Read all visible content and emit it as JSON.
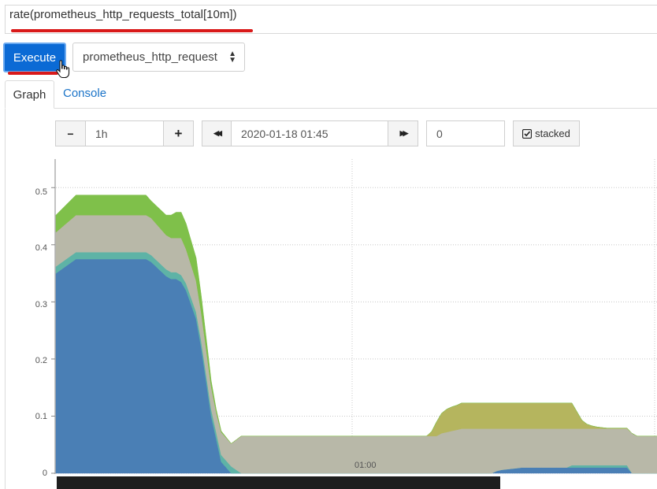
{
  "query": {
    "expression": "rate(prometheus_http_requests_total[10m])"
  },
  "toolbar": {
    "execute_label": "Execute",
    "metric_select_value": "prometheus_http_request",
    "metric_select_caret": "sort-caret-icon"
  },
  "tabs": [
    {
      "label": "Graph",
      "active": true
    },
    {
      "label": "Console",
      "active": false
    }
  ],
  "graph_controls": {
    "range_decrease_label": "−",
    "range_value": "1h",
    "range_increase_label": "+",
    "end_prev_label": "◀◀",
    "end_time_value": "2020-01-18 01:45",
    "end_next_label": "▶▶",
    "resolution_value": "0",
    "stacked_label": "stacked",
    "stacked_checked": true
  },
  "chart_data": {
    "type": "area",
    "stacked": true,
    "x_tick_labels": [
      "01:00"
    ],
    "y_tick_labels": [
      "0",
      "0.1",
      "0.2",
      "0.3",
      "0.4",
      "0.5"
    ],
    "ylim": [
      0,
      0.55
    ],
    "grid": true,
    "x_unit_note": "",
    "x": [
      0,
      4,
      18,
      19,
      22,
      23,
      24,
      25,
      26,
      28,
      29,
      30,
      31,
      32,
      33,
      35,
      37,
      38,
      40,
      41,
      43,
      44,
      46,
      47,
      48,
      49,
      50,
      51,
      52,
      53,
      56,
      57,
      58,
      59,
      60,
      61,
      62,
      63,
      64,
      65,
      66,
      67,
      68,
      69,
      70,
      71,
      72,
      73,
      74,
      75,
      76,
      77,
      78,
      79,
      80,
      81,
      82,
      83,
      84,
      85,
      86,
      87,
      88,
      89,
      90,
      91,
      92,
      93,
      94,
      95,
      96,
      97,
      98,
      99,
      100,
      101,
      102,
      103,
      104,
      105,
      106,
      107,
      108,
      109,
      110,
      111,
      112,
      113,
      114,
      115,
      116,
      117,
      118,
      119,
      120
    ],
    "series": [
      {
        "color": "#4a7fb5",
        "values": [
          0.35,
          0.375,
          0.375,
          0.37,
          0.345,
          0.34,
          0.34,
          0.335,
          0.32,
          0.27,
          0.22,
          0.16,
          0.1,
          0.06,
          0.02,
          0.0,
          0,
          0,
          0,
          0,
          0,
          0,
          0,
          0,
          0,
          0,
          0,
          0,
          0,
          0,
          0,
          0,
          0,
          0,
          0,
          0,
          0,
          0,
          0,
          0,
          0,
          0,
          0,
          0,
          0,
          0,
          0,
          0,
          0,
          0,
          0,
          0,
          0,
          0,
          0,
          0,
          0,
          0,
          0,
          0,
          0,
          0,
          0.004,
          0.006,
          0.007,
          0.008,
          0.009,
          0.01,
          0.01,
          0.01,
          0.01,
          0.01,
          0.01,
          0.01,
          0.01,
          0.01,
          0.01,
          0.01,
          0.01,
          0.01,
          0.01,
          0.01,
          0.01,
          0.01,
          0.01,
          0.01,
          0.01,
          0.01,
          0.01,
          0,
          0,
          0,
          0,
          0,
          0
        ]
      },
      {
        "color": "#5eb3a6",
        "values": [
          0.012,
          0.012,
          0.012,
          0.012,
          0.012,
          0.012,
          0.012,
          0.012,
          0.012,
          0.012,
          0.012,
          0.012,
          0.012,
          0.012,
          0.012,
          0.012,
          0,
          0,
          0,
          0,
          0,
          0,
          0,
          0,
          0,
          0,
          0,
          0,
          0,
          0,
          0,
          0,
          0,
          0,
          0,
          0,
          0,
          0,
          0,
          0,
          0,
          0,
          0,
          0,
          0,
          0,
          0,
          0,
          0,
          0,
          0,
          0,
          0,
          0,
          0,
          0,
          0,
          0,
          0,
          0,
          0,
          0,
          0,
          0,
          0,
          0,
          0,
          0,
          0,
          0,
          0,
          0,
          0,
          0,
          0,
          0,
          0,
          0.004,
          0.004,
          0.004,
          0.004,
          0.004,
          0.004,
          0.004,
          0.004,
          0.004,
          0.004,
          0.004,
          0.004,
          0,
          0,
          0,
          0,
          0,
          0
        ]
      },
      {
        "color": "#b8b8a8",
        "values": [
          0.06,
          0.065,
          0.065,
          0.065,
          0.06,
          0.06,
          0.06,
          0.065,
          0.06,
          0.055,
          0.05,
          0.045,
          0.04,
          0.035,
          0.04,
          0.04,
          0.065,
          0.065,
          0.065,
          0.065,
          0.065,
          0.065,
          0.065,
          0.065,
          0.065,
          0.065,
          0.065,
          0.065,
          0.065,
          0.065,
          0.065,
          0.065,
          0.065,
          0.065,
          0.065,
          0.065,
          0.065,
          0.065,
          0.065,
          0.065,
          0.065,
          0.065,
          0.065,
          0.065,
          0.065,
          0.065,
          0.065,
          0.065,
          0.065,
          0.065,
          0.065,
          0.07,
          0.072,
          0.074,
          0.076,
          0.078,
          0.078,
          0.078,
          0.078,
          0.078,
          0.078,
          0.078,
          0.074,
          0.072,
          0.071,
          0.07,
          0.069,
          0.068,
          0.068,
          0.068,
          0.068,
          0.068,
          0.068,
          0.068,
          0.068,
          0.068,
          0.068,
          0.064,
          0.064,
          0.064,
          0.064,
          0.064,
          0.064,
          0.064,
          0.064,
          0.064,
          0.064,
          0.064,
          0.064,
          0.07,
          0.065,
          0.065,
          0.065,
          0.065,
          0.065
        ]
      },
      {
        "color": "#b5b55e",
        "values": [
          0,
          0,
          0,
          0,
          0,
          0,
          0,
          0,
          0,
          0,
          0,
          0,
          0,
          0,
          0,
          0,
          0,
          0,
          0,
          0,
          0,
          0,
          0,
          0,
          0,
          0,
          0,
          0,
          0,
          0,
          0,
          0,
          0,
          0,
          0,
          0,
          0,
          0,
          0,
          0,
          0,
          0,
          0,
          0,
          0,
          0,
          0,
          0,
          0,
          0.008,
          0.025,
          0.035,
          0.04,
          0.042,
          0.043,
          0.045,
          0.045,
          0.045,
          0.045,
          0.045,
          0.045,
          0.045,
          0.045,
          0.045,
          0.045,
          0.045,
          0.045,
          0.045,
          0.045,
          0.045,
          0.045,
          0.045,
          0.045,
          0.045,
          0.045,
          0.045,
          0.045,
          0.045,
          0.03,
          0.015,
          0.008,
          0.005,
          0.003,
          0.002,
          0.001,
          0.001,
          0.001,
          0.001,
          0.001,
          0,
          0,
          0,
          0,
          0,
          0
        ]
      },
      {
        "color": "#7fc04a",
        "values": [
          0.03,
          0.035,
          0.035,
          0.03,
          0.035,
          0.04,
          0.045,
          0.045,
          0.045,
          0.04,
          0.03,
          0.02,
          0.01,
          0.005,
          0.002,
          0.0,
          0,
          0,
          0,
          0,
          0,
          0,
          0,
          0,
          0,
          0,
          0,
          0,
          0,
          0,
          0,
          0,
          0,
          0,
          0,
          0,
          0,
          0,
          0,
          0,
          0,
          0,
          0,
          0,
          0,
          0,
          0,
          0,
          0,
          0,
          0,
          0,
          0,
          0,
          0,
          0,
          0,
          0,
          0,
          0,
          0,
          0,
          0,
          0,
          0,
          0,
          0,
          0,
          0,
          0,
          0,
          0,
          0,
          0,
          0,
          0,
          0,
          0,
          0,
          0,
          0,
          0,
          0,
          0,
          0,
          0,
          0,
          0,
          0,
          0,
          0,
          0,
          0,
          0,
          0
        ]
      }
    ]
  }
}
